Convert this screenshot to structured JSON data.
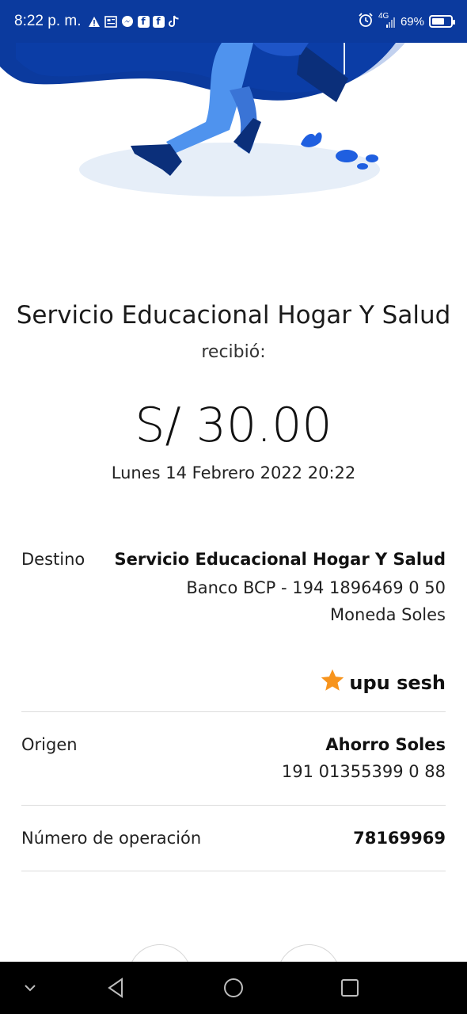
{
  "status_bar": {
    "time": "8:22 p. m.",
    "network": "4G",
    "battery": "69%",
    "battery_level": 0.69
  },
  "receipt": {
    "recipient_name": "Servicio Educacional Hogar Y Salud",
    "received_label": "recibió:",
    "amount": "S/ 30.00",
    "datetime": "Lunes 14 Febrero 2022 20:22"
  },
  "destination": {
    "label": "Destino",
    "name": "Servicio Educacional Hogar Y Salud",
    "account": "Banco BCP - 194 1896469 0 50",
    "currency": "Moneda Soles",
    "favorite_name": "upu sesh"
  },
  "origin": {
    "label": "Origen",
    "account_type": "Ahorro Soles",
    "account_number": "191 01355399 0 88"
  },
  "operation": {
    "label": "Número de operación",
    "number": "78169969"
  },
  "colors": {
    "brand_blue": "#0b3a9e",
    "star": "#f7941d"
  },
  "icons": [
    "warning-icon",
    "news-icon",
    "messenger-icon",
    "facebook-icon",
    "tiktok-icon",
    "alarm-icon",
    "signal-icon",
    "battery-icon",
    "star-icon",
    "chevron-down-icon",
    "back-icon",
    "home-icon",
    "recents-icon"
  ]
}
